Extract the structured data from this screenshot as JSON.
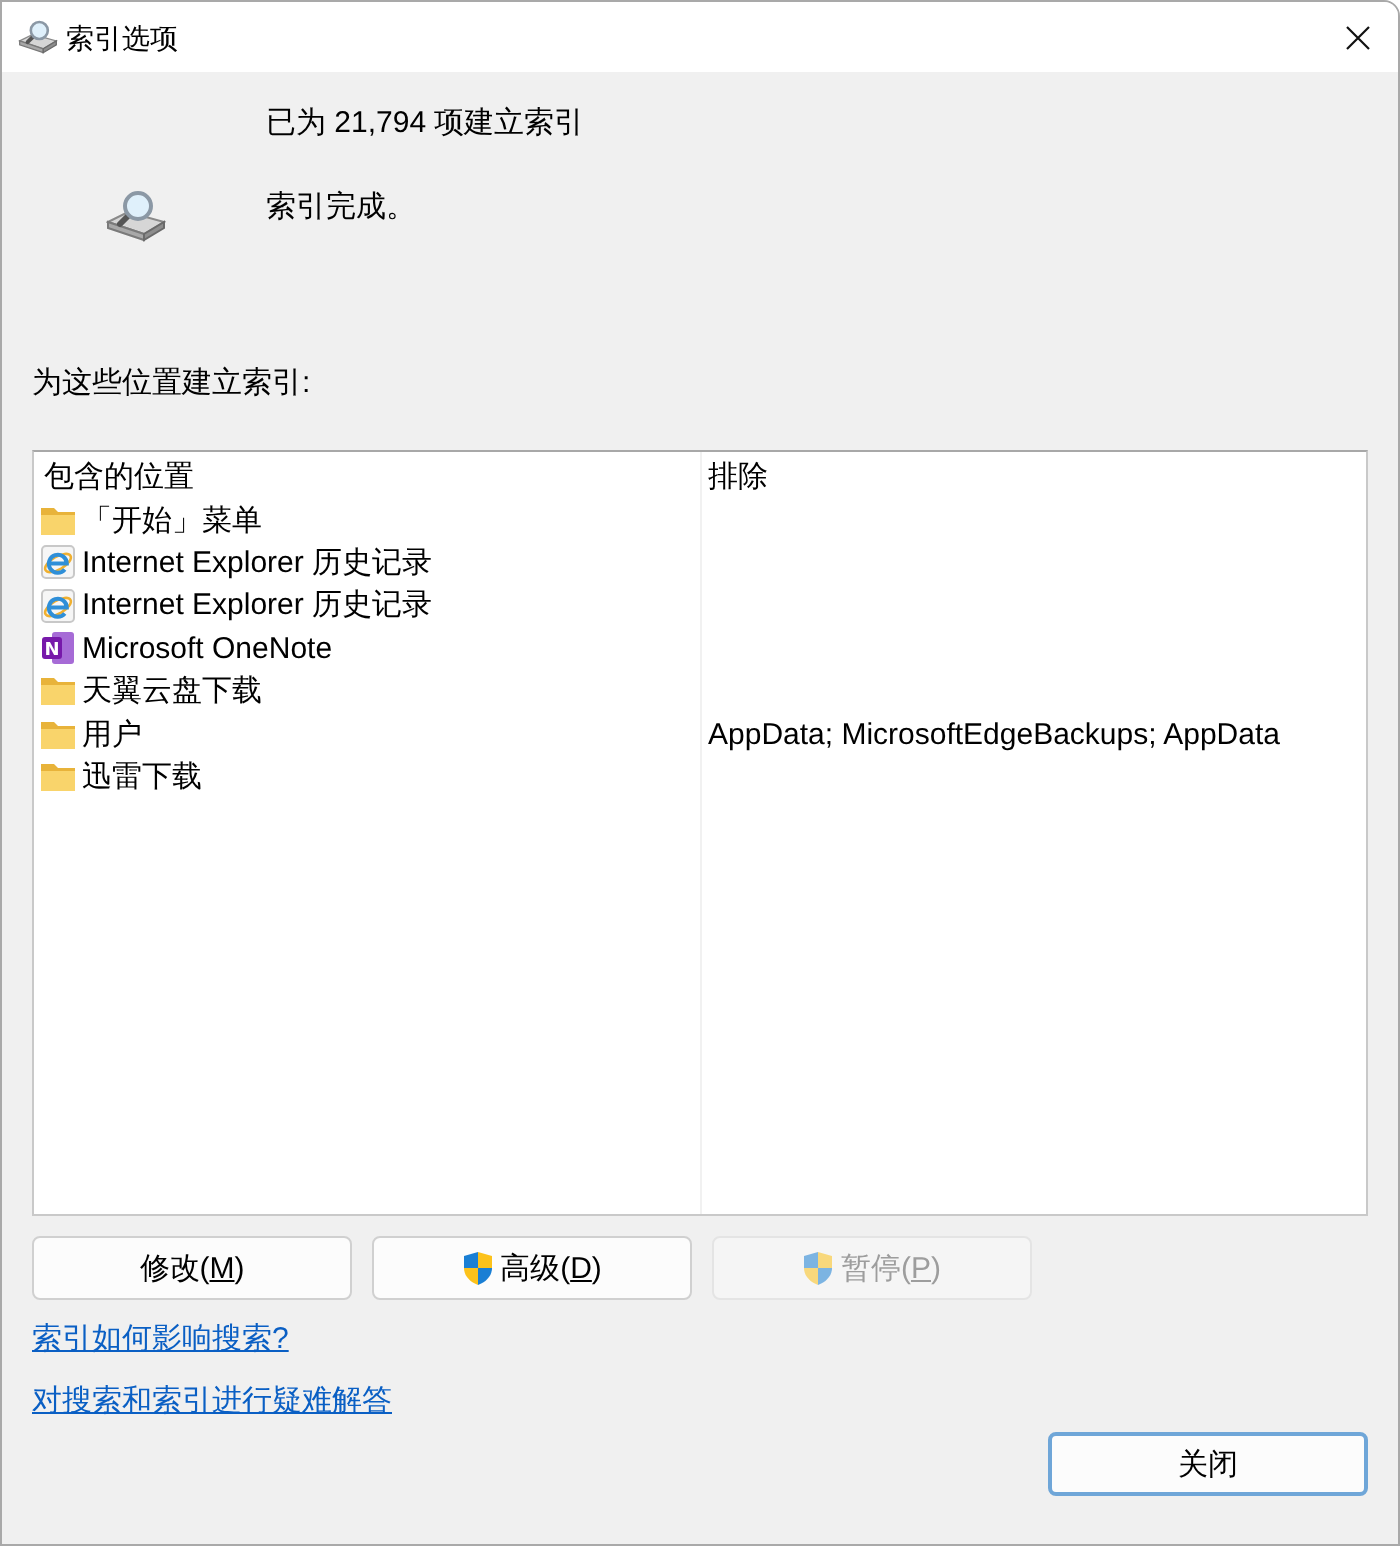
{
  "window": {
    "title": "索引选项"
  },
  "status": {
    "count_text": "已为 21,794 项建立索引",
    "state_text": "索引完成。"
  },
  "locations_label": "为这些位置建立索引:",
  "table": {
    "columns": [
      "包含的位置",
      "排除"
    ],
    "rows": [
      {
        "kind": "folder",
        "location": "「开始」菜单"
      },
      {
        "kind": "browser",
        "location": "Internet Explorer 历史记录"
      },
      {
        "kind": "browser",
        "location": "Internet Explorer 历史记录"
      },
      {
        "kind": "notebook",
        "location": "Microsoft OneNote",
        "icon_letter": "N"
      },
      {
        "kind": "folder",
        "location": "天翼云盘下载"
      },
      {
        "kind": "folder",
        "location": "用户",
        "exclude": "AppData; MicrosoftEdgeBackups; AppData"
      },
      {
        "kind": "folder",
        "location": "迅雷下载"
      }
    ]
  },
  "buttons": [
    {
      "kind": "plain",
      "label": "修改(",
      "access_key": "M",
      "label_end": ")",
      "disabled": false
    },
    {
      "kind": "elevated",
      "label": "高级(",
      "access_key": "D",
      "label_end": ")",
      "disabled": false
    },
    {
      "kind": "elevated",
      "label": "暂停(",
      "access_key": "P",
      "label_end": ")",
      "disabled": true
    }
  ],
  "links": [
    "索引如何影响搜索?",
    "对搜索和索引进行疑难解答"
  ],
  "close_button": {
    "label": "关闭",
    "default": true
  }
}
